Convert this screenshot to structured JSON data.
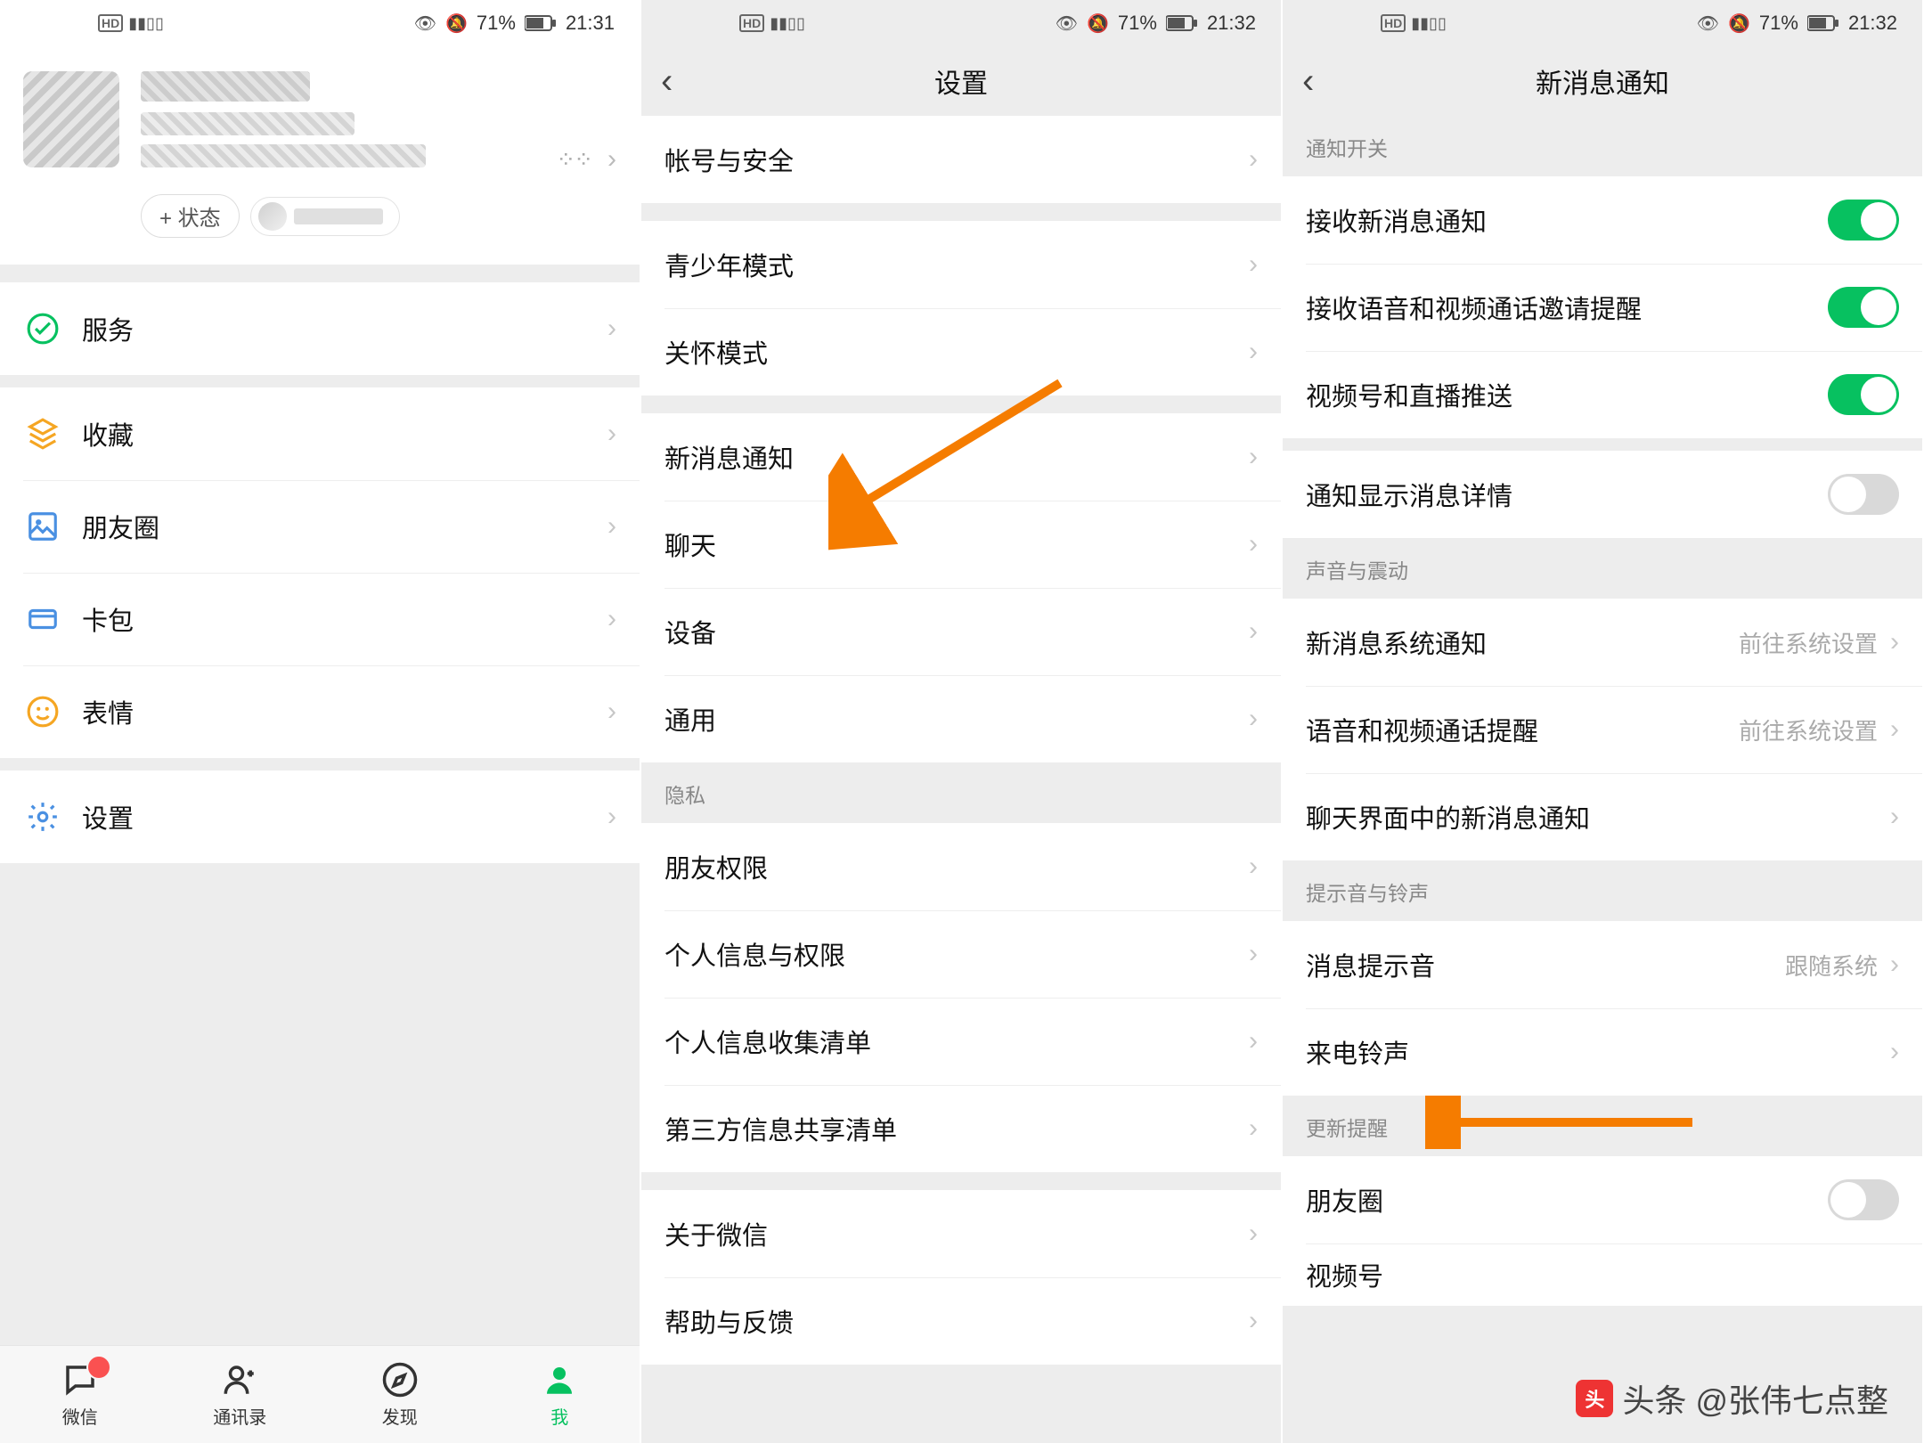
{
  "status": {
    "battery_text": "71%",
    "hd": "HD"
  },
  "screen1": {
    "time": "21:31",
    "status_pill_label": "+ 状态",
    "menu": {
      "services": "服务",
      "favorites": "收藏",
      "moments": "朋友圈",
      "cards": "卡包",
      "stickers": "表情",
      "settings": "设置"
    },
    "tabs": {
      "chats": "微信",
      "contacts": "通讯录",
      "discover": "发现",
      "me": "我"
    }
  },
  "screen2": {
    "time": "21:32",
    "title": "设置",
    "items": {
      "account_security": "帐号与安全",
      "youth_mode": "青少年模式",
      "care_mode": "关怀模式",
      "notifications": "新消息通知",
      "chat": "聊天",
      "device": "设备",
      "general": "通用",
      "privacy_header": "隐私",
      "friend_perm": "朋友权限",
      "personal_info_perm": "个人信息与权限",
      "personal_info_list": "个人信息收集清单",
      "third_party_list": "第三方信息共享清单",
      "about": "关于微信",
      "help": "帮助与反馈"
    }
  },
  "screen3": {
    "time": "21:32",
    "title": "新消息通知",
    "section_switch": "通知开关",
    "items": {
      "receive_new_msg": "接收新消息通知",
      "receive_voip": "接收语音和视频通话邀请提醒",
      "channel_push": "视频号和直播推送",
      "show_detail": "通知显示消息详情"
    },
    "section_sound": "声音与震动",
    "sound": {
      "sys_notif": {
        "label": "新消息系统通知",
        "value": "前往系统设置"
      },
      "voip_remind": {
        "label": "语音和视频通话提醒",
        "value": "前往系统设置"
      },
      "chat_page_notif": "聊天界面中的新消息通知"
    },
    "section_ring": "提示音与铃声",
    "ring": {
      "msg_tone": {
        "label": "消息提示音",
        "value": "跟随系统"
      },
      "call_ring": "来电铃声"
    },
    "section_update": "更新提醒",
    "update": {
      "moments": "朋友圈",
      "channel": "视频号"
    }
  },
  "watermark": "头条 @张伟七点整"
}
